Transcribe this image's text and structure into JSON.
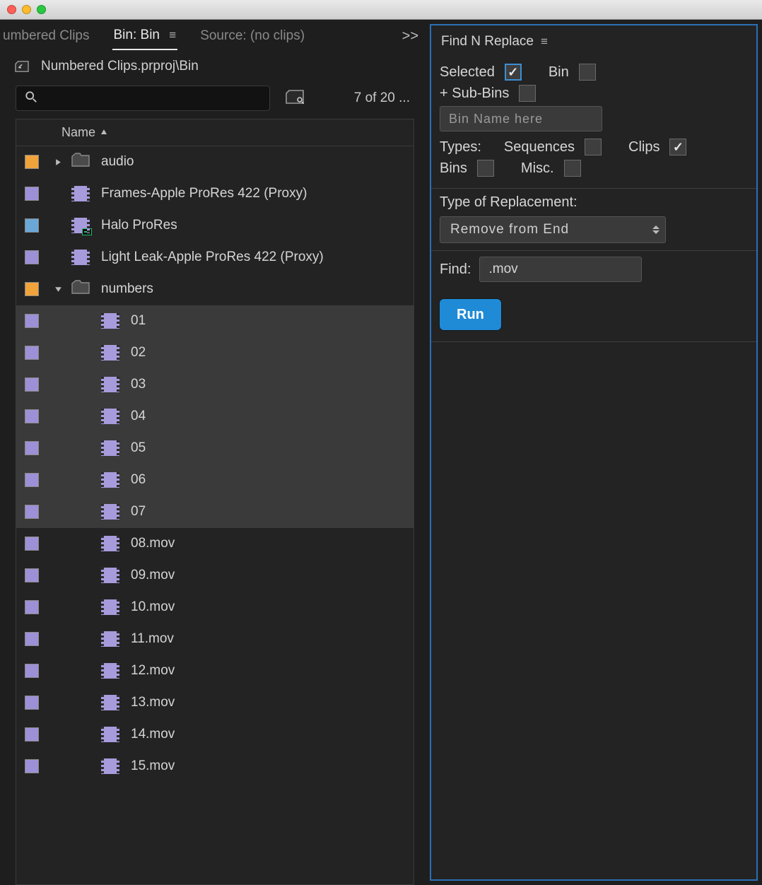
{
  "tabs": {
    "left_partial": "umbered Clips",
    "active": "Bin: Bin",
    "source": "Source: (no clips)",
    "overflow": ">>"
  },
  "breadcrumb": "Numbered Clips.prproj\\Bin",
  "search": {
    "placeholder": ""
  },
  "count_text": "7 of 20 ...",
  "columns": {
    "name": "Name"
  },
  "rows": [
    {
      "swatch": "orange",
      "twisty": "right",
      "indent": 0,
      "icon": "folder",
      "name": "audio",
      "selected": false
    },
    {
      "swatch": "purple",
      "twisty": "",
      "indent": 0,
      "icon": "clip",
      "name": "Frames-Apple ProRes 422 (Proxy)",
      "selected": false
    },
    {
      "swatch": "blue",
      "twisty": "",
      "indent": 0,
      "icon": "seq",
      "name": "Halo ProRes",
      "selected": false
    },
    {
      "swatch": "purple",
      "twisty": "",
      "indent": 0,
      "icon": "clip",
      "name": "Light Leak-Apple ProRes 422 (Proxy)",
      "selected": false
    },
    {
      "swatch": "orange",
      "twisty": "down",
      "indent": 0,
      "icon": "folder",
      "name": "numbers",
      "selected": false
    },
    {
      "swatch": "purple",
      "twisty": "",
      "indent": 1,
      "icon": "clip",
      "name": "01",
      "selected": true
    },
    {
      "swatch": "purple",
      "twisty": "",
      "indent": 1,
      "icon": "clip",
      "name": "02",
      "selected": true
    },
    {
      "swatch": "purple",
      "twisty": "",
      "indent": 1,
      "icon": "clip",
      "name": "03",
      "selected": true
    },
    {
      "swatch": "purple",
      "twisty": "",
      "indent": 1,
      "icon": "clip",
      "name": "04",
      "selected": true
    },
    {
      "swatch": "purple",
      "twisty": "",
      "indent": 1,
      "icon": "clip",
      "name": "05",
      "selected": true
    },
    {
      "swatch": "purple",
      "twisty": "",
      "indent": 1,
      "icon": "clip",
      "name": "06",
      "selected": true
    },
    {
      "swatch": "purple",
      "twisty": "",
      "indent": 1,
      "icon": "clip",
      "name": "07",
      "selected": true
    },
    {
      "swatch": "purple",
      "twisty": "",
      "indent": 1,
      "icon": "clip",
      "name": "08.mov",
      "selected": false
    },
    {
      "swatch": "purple",
      "twisty": "",
      "indent": 1,
      "icon": "clip",
      "name": "09.mov",
      "selected": false
    },
    {
      "swatch": "purple",
      "twisty": "",
      "indent": 1,
      "icon": "clip",
      "name": "10.mov",
      "selected": false
    },
    {
      "swatch": "purple",
      "twisty": "",
      "indent": 1,
      "icon": "clip",
      "name": "11.mov",
      "selected": false
    },
    {
      "swatch": "purple",
      "twisty": "",
      "indent": 1,
      "icon": "clip",
      "name": "12.mov",
      "selected": false
    },
    {
      "swatch": "purple",
      "twisty": "",
      "indent": 1,
      "icon": "clip",
      "name": "13.mov",
      "selected": false
    },
    {
      "swatch": "purple",
      "twisty": "",
      "indent": 1,
      "icon": "clip",
      "name": "14.mov",
      "selected": false
    },
    {
      "swatch": "purple",
      "twisty": "",
      "indent": 1,
      "icon": "clip",
      "name": "15.mov",
      "selected": false
    }
  ],
  "panel": {
    "title": "Find N Replace",
    "scope": {
      "selected_label": "Selected",
      "selected_checked": true,
      "bin_label": "Bin",
      "bin_checked": false,
      "subbins_label": "+ Sub-Bins",
      "subbins_checked": false,
      "bin_name_placeholder": "Bin Name here"
    },
    "types": {
      "label": "Types:",
      "sequences_label": "Sequences",
      "sequences_checked": false,
      "clips_label": "Clips",
      "clips_checked": true,
      "bins_label": "Bins",
      "bins_checked": false,
      "misc_label": "Misc.",
      "misc_checked": false
    },
    "replacement": {
      "label": "Type of Replacement:",
      "value": "Remove from End"
    },
    "find": {
      "label": "Find:",
      "value": ".mov"
    },
    "run_label": "Run"
  }
}
